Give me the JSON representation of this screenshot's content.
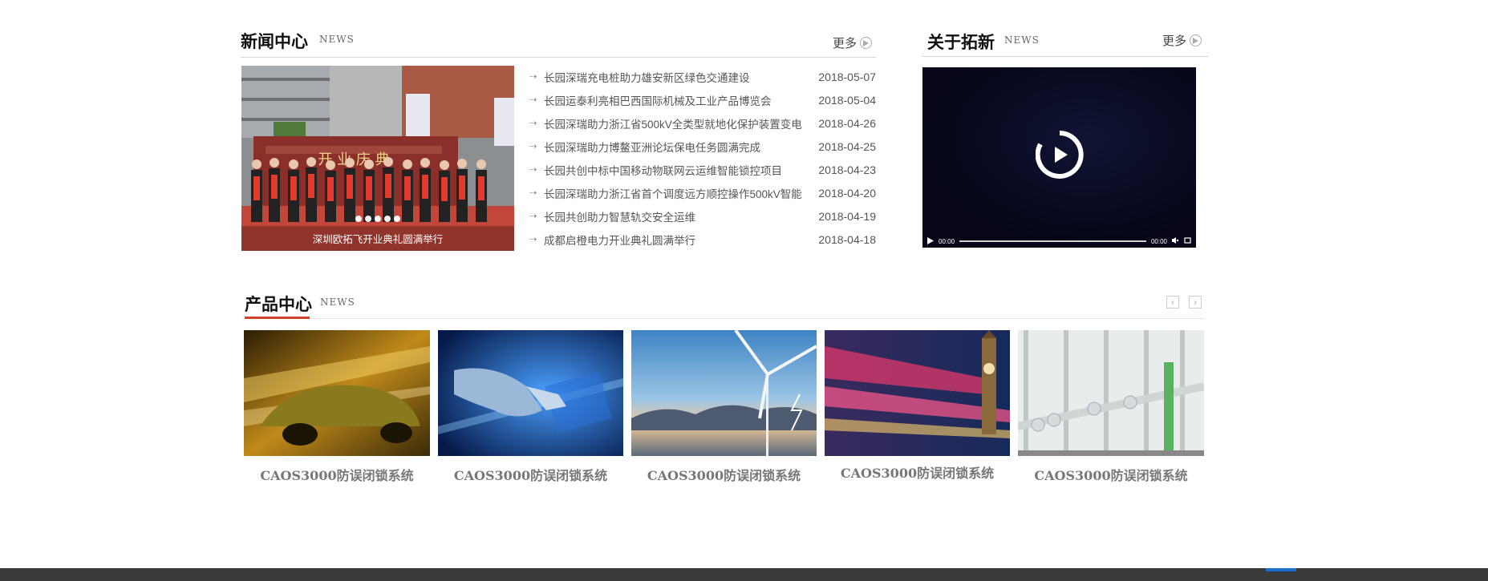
{
  "news": {
    "title": "新闻中心",
    "subtitle": "NEWS",
    "more_label": "更多",
    "slide_caption": "深圳欧拓飞开业典礼圆满举行",
    "slide_dots": 5,
    "items": [
      {
        "title": "长园深瑞充电桩助力雄安新区绿色交通建设",
        "date": "2018-05-07"
      },
      {
        "title": "长园运泰利亮相巴西国际机械及工业产品博览会",
        "date": "2018-05-04"
      },
      {
        "title": "长园深瑞助力浙江省500kV全类型就地化保护装置变电",
        "date": "2018-04-26"
      },
      {
        "title": "长园深瑞助力博鳌亚洲论坛保电任务圆满完成",
        "date": "2018-04-25"
      },
      {
        "title": "长园共创中标中国移动物联网云运维智能锁控项目",
        "date": "2018-04-23"
      },
      {
        "title": "长园深瑞助力浙江省首个调度远方顺控操作500kV智能",
        "date": "2018-04-20"
      },
      {
        "title": "长园共创助力智慧轨交安全运维",
        "date": "2018-04-19"
      },
      {
        "title": "成都启橙电力开业典礼圆满举行",
        "date": "2018-04-18"
      }
    ]
  },
  "about": {
    "title": "关于拓新",
    "subtitle": "NEWS",
    "more_label": "更多",
    "video": {
      "time_current": "00:00",
      "time_total": "00:00"
    }
  },
  "products": {
    "title": "产品中心",
    "subtitle": "NEWS",
    "prev_icon": "chevron-left-icon",
    "next_icon": "chevron-right-icon",
    "items": [
      {
        "caption": "CAOS3000防误闭锁系统",
        "image": "sports-car"
      },
      {
        "caption": "CAOS3000防误闭锁系统",
        "image": "robot-hand"
      },
      {
        "caption": "CAOS3000防误闭锁系统",
        "image": "wind-turbine"
      },
      {
        "caption": "CAOS3000防误闭锁系统",
        "image": "london-bus"
      },
      {
        "caption": "CAOS3000防误闭锁系统",
        "image": "substation"
      }
    ]
  },
  "colors": {
    "accent_red": "#d0402c",
    "footer": "#3a3a3a",
    "footer_accent": "#1a6fd0"
  }
}
